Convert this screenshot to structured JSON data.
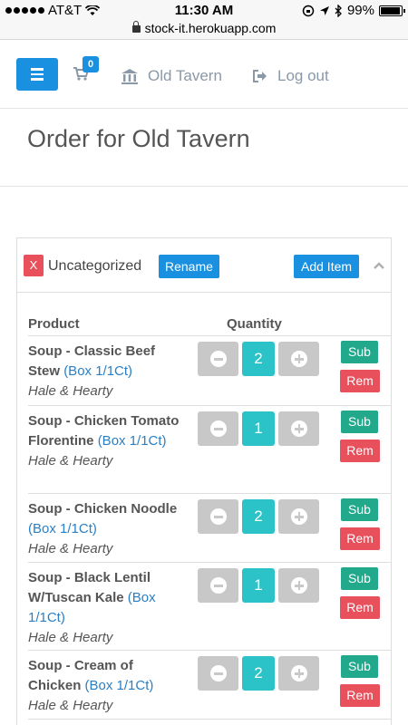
{
  "status_bar": {
    "carrier": "AT&T",
    "time": "11:30 AM",
    "battery": "99%",
    "battery_level": 0.99,
    "url": "stock-it.herokuapp.com"
  },
  "nav": {
    "cart_count": "0",
    "location": "Old Tavern",
    "logout": "Log out"
  },
  "page": {
    "title": "Order for Old Tavern"
  },
  "category": {
    "delete_label": "X",
    "name": "Uncategorized",
    "rename_label": "Rename",
    "add_item_label": "Add Item"
  },
  "table": {
    "headers": {
      "product": "Product",
      "quantity": "Quantity"
    },
    "sub_label": "Sub",
    "rem_label": "Rem",
    "rows": [
      {
        "name": "Soup - Classic Beef Stew",
        "unit": "(Box 1/1Ct)",
        "brand": "Hale & Hearty",
        "qty": "2"
      },
      {
        "name": "Soup - Chicken Tomato Florentine",
        "unit": "(Box 1/1Ct)",
        "brand": "Hale & Hearty",
        "qty": "1"
      },
      {
        "name": "Soup - Chicken Noodle",
        "unit": "(Box 1/1Ct)",
        "brand": "Hale & Hearty",
        "qty": "2"
      },
      {
        "name": "Soup - Black Lentil W/Tuscan Kale",
        "unit": "(Box 1/1Ct)",
        "brand": "Hale & Hearty",
        "qty": "1"
      },
      {
        "name": "Soup - Cream of Chicken",
        "unit": "(Box 1/1Ct)",
        "brand": "Hale & Hearty",
        "qty": "2"
      }
    ]
  }
}
